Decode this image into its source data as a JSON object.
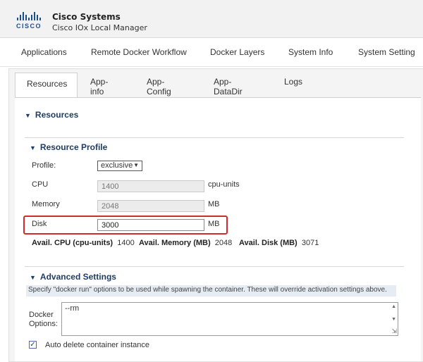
{
  "header": {
    "logo_text": "CISCO",
    "title": "Cisco Systems",
    "subtitle": "Cisco IOx Local Manager"
  },
  "topnav": [
    {
      "label": "Applications"
    },
    {
      "label": "Remote Docker Workflow"
    },
    {
      "label": "Docker Layers"
    },
    {
      "label": "System Info"
    },
    {
      "label": "System Setting"
    }
  ],
  "tabs": [
    {
      "label": "Resources",
      "active": true
    },
    {
      "label": "App-info"
    },
    {
      "label": "App-Config"
    },
    {
      "label": "App-DataDir"
    },
    {
      "label": "Logs"
    }
  ],
  "resources": {
    "section_title": "Resources",
    "profile_section_title": "Resource Profile",
    "profile": {
      "label": "Profile:",
      "value": "exclusive"
    },
    "cpu": {
      "label": "CPU",
      "value": "1400",
      "unit": "cpu-units"
    },
    "memory": {
      "label": "Memory",
      "value": "2048",
      "unit": "MB"
    },
    "disk": {
      "label": "Disk",
      "value": "3000",
      "unit": "MB"
    },
    "avail": {
      "cpu_label": "Avail. CPU (cpu-units)",
      "cpu_value": "1400",
      "memory_label": "Avail. Memory (MB)",
      "memory_value": "2048",
      "disk_label": "Avail. Disk (MB)",
      "disk_value": "3071"
    }
  },
  "advanced": {
    "section_title": "Advanced Settings",
    "note": "Specify \"docker run\" options to be used while spawning the container. These will override activation settings above.",
    "docker_options_label_1": "Docker",
    "docker_options_label_2": "Options:",
    "docker_options_value": "--rm",
    "auto_delete_label": "Auto delete container instance",
    "auto_delete_checked": true
  },
  "colors": {
    "accent": "#1f3c66",
    "highlight": "#d22b2b",
    "brand": "#1b4f8a"
  }
}
